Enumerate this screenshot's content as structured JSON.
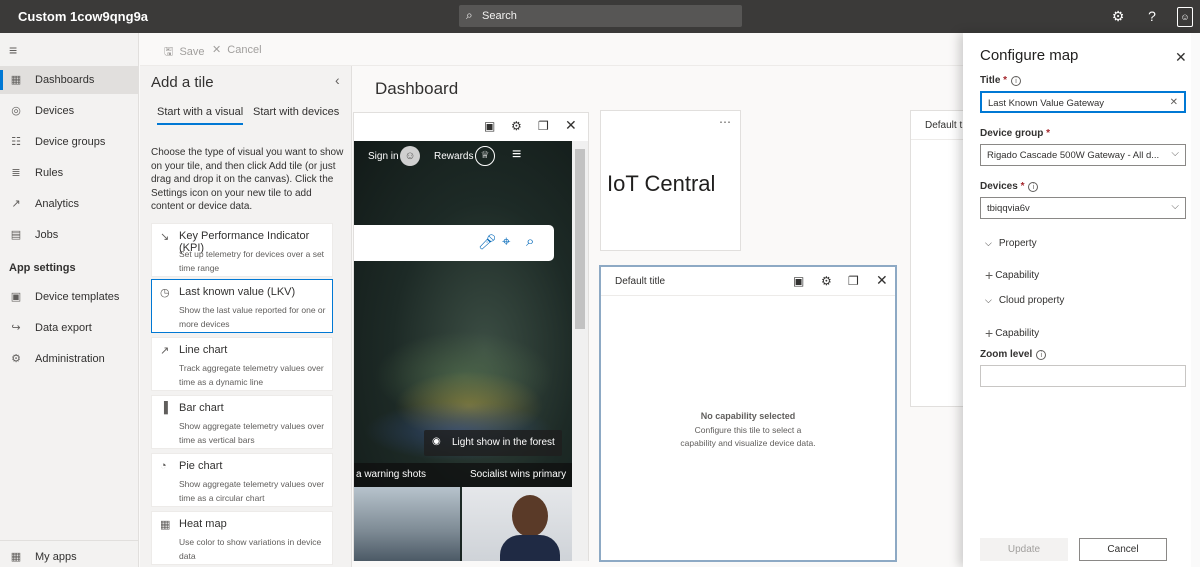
{
  "topbar": {
    "app_title": "Custom 1cow9qng9a",
    "search_label": "Search",
    "settings_icon": "gear-icon",
    "help_icon": "question-icon",
    "user_icon": "user-icon"
  },
  "toolbar": {
    "save_label": "Save",
    "cancel_label": "Cancel"
  },
  "leftnav": {
    "items": [
      {
        "label": "Dashboards",
        "icon": "dashboard-icon",
        "active": true
      },
      {
        "label": "Devices",
        "icon": "device-icon"
      },
      {
        "label": "Device groups",
        "icon": "device-groups-icon"
      },
      {
        "label": "Rules",
        "icon": "rules-icon"
      },
      {
        "label": "Analytics",
        "icon": "analytics-icon"
      },
      {
        "label": "Jobs",
        "icon": "jobs-icon"
      }
    ],
    "section": "App settings",
    "settings_items": [
      {
        "label": "Device templates",
        "icon": "device-templates-icon"
      },
      {
        "label": "Data export",
        "icon": "data-export-icon"
      },
      {
        "label": "Administration",
        "icon": "administration-icon"
      }
    ],
    "bottom_item": {
      "label": "My apps",
      "icon": "my-apps-icon"
    }
  },
  "add_tile": {
    "title": "Add a tile",
    "tabs": [
      "Start with a visual",
      "Start with devices"
    ],
    "description": "Choose the type of visual you want to show on your tile, and then click Add tile (or just drag and drop it on the canvas). Click the Settings icon on your new tile to add content or device data.",
    "tiles": [
      {
        "name": "Key Performance Indicator (KPI)",
        "desc": "Set up telemetry for devices over a set time range"
      },
      {
        "name": "Last known value (LKV)",
        "desc": "Show the last value reported for one or more devices"
      },
      {
        "name": "Line chart",
        "desc": "Track aggregate telemetry values over time as a dynamic line"
      },
      {
        "name": "Bar chart",
        "desc": "Show aggregate telemetry values over time as vertical bars"
      },
      {
        "name": "Pie chart",
        "desc": "Show aggregate telemetry values over time as a circular chart"
      },
      {
        "name": "Heat map",
        "desc": "Use color to show variations in device data"
      }
    ]
  },
  "dashboard": {
    "title": "Dashboard",
    "web_tile": {
      "sign_in": "Sign in",
      "rewards": "Rewards",
      "caption": "Light show in the forest",
      "news_left": "a warning shots",
      "news_right": "Socialist wins primary"
    },
    "iot_tile": {
      "title": "IoT Central"
    },
    "default_tile": {
      "title": "Default title",
      "empty_title": "No capability selected",
      "empty_desc": "Configure this tile to select a capability and visualize device data."
    },
    "default_tile2": {
      "title": "Default t"
    }
  },
  "configure": {
    "title": "Configure map",
    "title_label": "Title",
    "title_value": "Last Known Value Gateway",
    "group_label": "Device group",
    "group_value": "Rigado Cascade 500W Gateway - All d...",
    "devices_label": "Devices",
    "devices_value": "tbiqqvia6v",
    "property_section": "Property",
    "cloud_section": "Cloud property",
    "capability_label": "Capability",
    "zoom_label": "Zoom level",
    "zoom_value": "",
    "update_label": "Update",
    "cancel_label": "Cancel"
  }
}
